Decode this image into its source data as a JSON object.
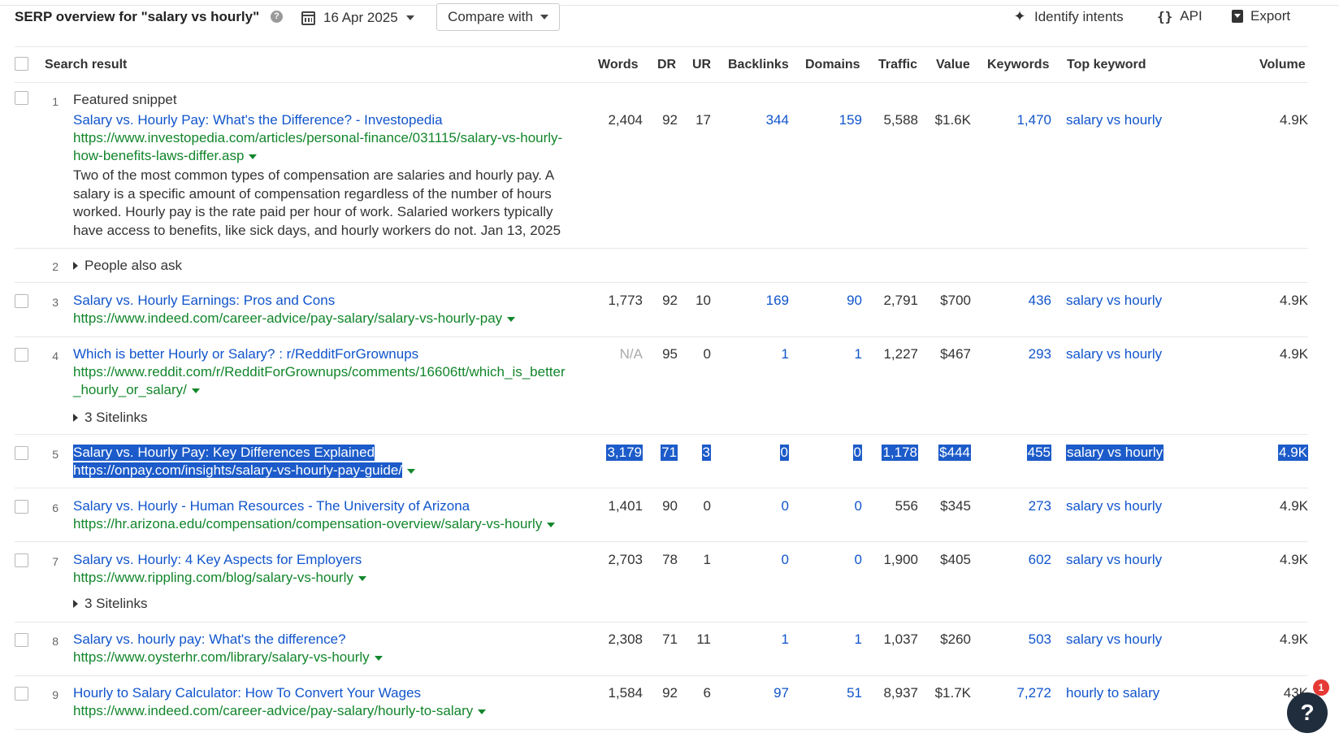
{
  "header": {
    "title": "SERP overview for \"salary vs hourly\"",
    "help": "?",
    "date": "16 Apr 2025",
    "compare_label": "Compare with",
    "identify_intents": "Identify intents",
    "api": "API",
    "export": "Export"
  },
  "columns": {
    "search_result": "Search result",
    "words": "Words",
    "dr": "DR",
    "ur": "UR",
    "backlinks": "Backlinks",
    "domains": "Domains",
    "traffic": "Traffic",
    "value": "Value",
    "keywords": "Keywords",
    "top_keyword": "Top keyword",
    "volume": "Volume"
  },
  "results": [
    {
      "rank": "1",
      "feature_label": "Featured snippet",
      "title": "Salary vs. Hourly Pay: What's the Difference? - Investopedia",
      "url_line1": "https://www.investopedia.com/articles/personal-finance/031115/salary-vs-hourly-",
      "url_line2": "how-benefits-laws-differ.asp",
      "snippet": "Two of the most common types of compensation are salaries and hourly pay. A salary is a specific amount of compensation regardless of the number of hours worked. Hourly pay is the rate paid per hour of work. Salaried workers typically have access to benefits, like sick days, and hourly workers do not. Jan 13, 2025",
      "words": "2,404",
      "dr": "92",
      "ur": "17",
      "backlinks": "344",
      "domains": "159",
      "traffic": "5,588",
      "value": "$1.6K",
      "keywords": "1,470",
      "top_keyword": "salary vs hourly",
      "volume": "4.9K"
    },
    {
      "rank": "2",
      "expander": "People also ask"
    },
    {
      "rank": "3",
      "title": "Salary vs. Hourly Earnings: Pros and Cons",
      "url_line1": "https://www.indeed.com/career-advice/pay-salary/salary-vs-hourly-pay",
      "words": "1,773",
      "dr": "92",
      "ur": "10",
      "backlinks": "169",
      "domains": "90",
      "traffic": "2,791",
      "value": "$700",
      "keywords": "436",
      "top_keyword": "salary vs hourly",
      "volume": "4.9K"
    },
    {
      "rank": "4",
      "title": "Which is better Hourly or Salary? : r/RedditForGrownups",
      "url_line1": "https://www.reddit.com/r/RedditForGrownups/comments/16606tt/which_is_better",
      "url_line2": "_hourly_or_salary/",
      "sitelinks": "3 Sitelinks",
      "words": "N/A",
      "dr": "95",
      "ur": "0",
      "backlinks": "1",
      "domains": "1",
      "traffic": "1,227",
      "value": "$467",
      "keywords": "293",
      "top_keyword": "salary vs hourly",
      "volume": "4.9K"
    },
    {
      "rank": "5",
      "title": "Salary vs. Hourly Pay: Key Differences Explained",
      "url_line1": "https://onpay.com/insights/salary-vs-hourly-pay-guide/",
      "words": "3,179",
      "dr": "71",
      "ur": "3",
      "backlinks": "0",
      "domains": "0",
      "traffic": "1,178",
      "value": "$444",
      "keywords": "455",
      "top_keyword": "salary vs hourly",
      "volume": "4.9K"
    },
    {
      "rank": "6",
      "title": "Salary vs. Hourly - Human Resources - The University of Arizona",
      "url_line1": "https://hr.arizona.edu/compensation/compensation-overview/salary-vs-hourly",
      "words": "1,401",
      "dr": "90",
      "ur": "0",
      "backlinks": "0",
      "domains": "0",
      "traffic": "556",
      "value": "$345",
      "keywords": "273",
      "top_keyword": "salary vs hourly",
      "volume": "4.9K"
    },
    {
      "rank": "7",
      "title": "Salary vs. Hourly: 4 Key Aspects for Employers",
      "url_line1": "https://www.rippling.com/blog/salary-vs-hourly",
      "sitelinks": "3 Sitelinks",
      "words": "2,703",
      "dr": "78",
      "ur": "1",
      "backlinks": "0",
      "domains": "0",
      "traffic": "1,900",
      "value": "$405",
      "keywords": "602",
      "top_keyword": "salary vs hourly",
      "volume": "4.9K"
    },
    {
      "rank": "8",
      "title": "Salary vs. hourly pay: What's the difference?",
      "url_line1": "https://www.oysterhr.com/library/salary-vs-hourly",
      "words": "2,308",
      "dr": "71",
      "ur": "11",
      "backlinks": "1",
      "domains": "1",
      "traffic": "1,037",
      "value": "$260",
      "keywords": "503",
      "top_keyword": "salary vs hourly",
      "volume": "4.9K"
    },
    {
      "rank": "9",
      "title": "Hourly to Salary Calculator: How To Convert Your Wages",
      "url_line1": "https://www.indeed.com/career-advice/pay-salary/hourly-to-salary",
      "words": "1,584",
      "dr": "92",
      "ur": "6",
      "backlinks": "97",
      "domains": "51",
      "traffic": "8,937",
      "value": "$1.7K",
      "keywords": "7,272",
      "top_keyword": "hourly to salary",
      "volume": "43K"
    }
  ],
  "widgets": {
    "help_bubble": "?",
    "notification_count": "1"
  }
}
